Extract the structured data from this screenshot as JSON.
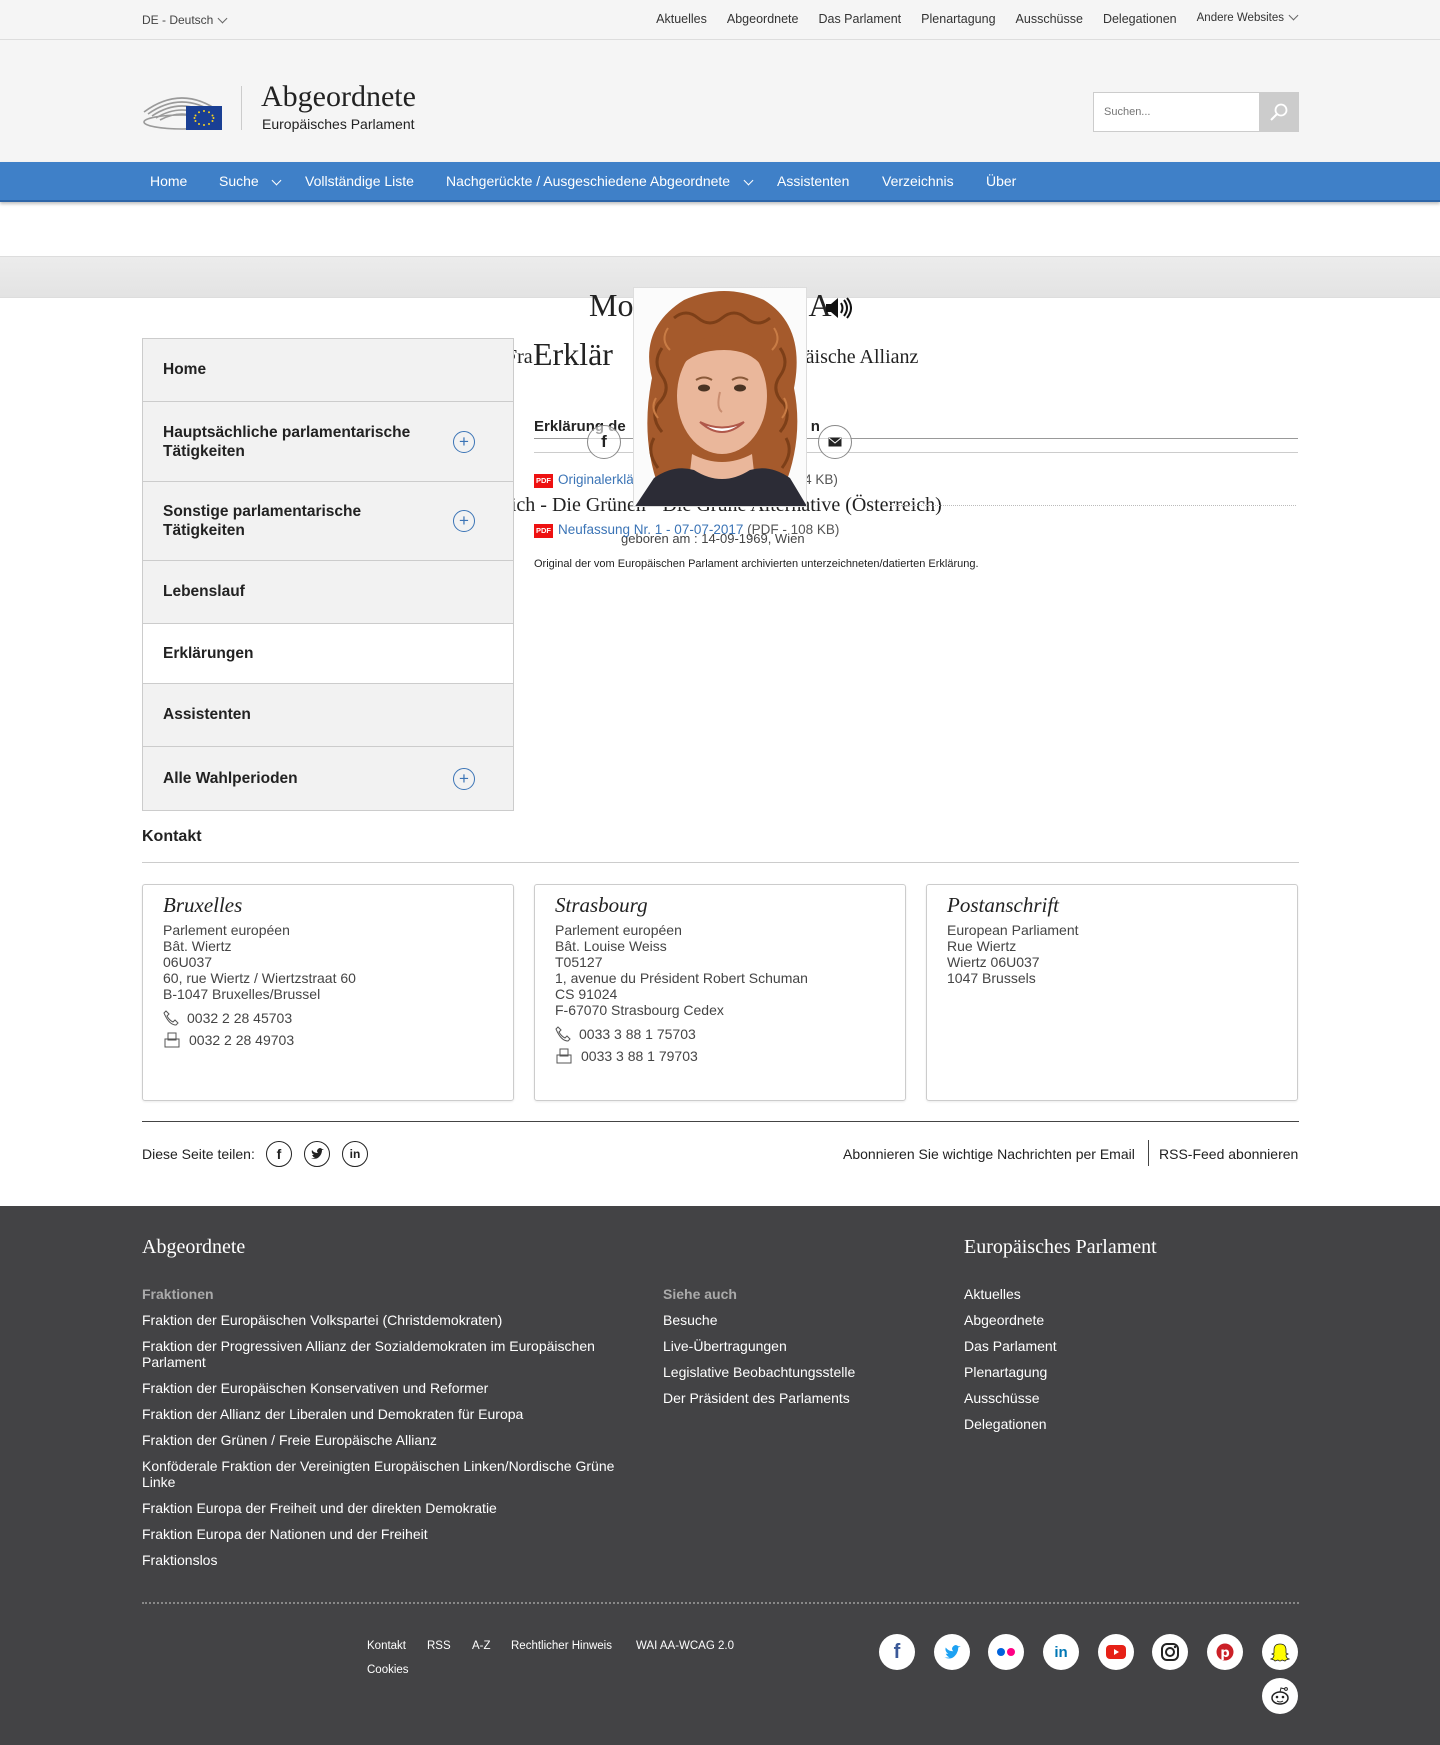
{
  "topbar": {
    "language": "DE - Deutsch",
    "links": [
      "Aktuelles",
      "Abgeordnete",
      "Das Parlament",
      "Plenartagung",
      "Ausschüsse",
      "Delegationen"
    ],
    "other_sites": "Andere Websites"
  },
  "header": {
    "title": "Abgeordnete",
    "subtitle": "Europäisches Parlament",
    "search_placeholder": "Suchen..."
  },
  "nav": {
    "items": [
      "Home",
      "Suche",
      "Vollständige Liste",
      "Nachgerückte / Ausgeschiedene Abgeordnete",
      "Assistenten",
      "Verzeichnis",
      "Über"
    ]
  },
  "profile": {
    "name_visible": "Mo",
    "name_visible_end": "A",
    "page_heading": "Erklär",
    "group_left": "Fra",
    "group_right": "päische Allianz",
    "party": "eich - Die Grünen - Die Grüne Alternative (Österreich)",
    "born": "geboren am : 14-09-1969, Wien"
  },
  "sidebar": {
    "items": [
      {
        "label": "Home",
        "expandable": false,
        "active": false
      },
      {
        "label": "Hauptsächliche parlamentarische Tätigkeiten",
        "expandable": true,
        "active": false
      },
      {
        "label": "Sonstige parlamentarische Tätigkeiten",
        "expandable": true,
        "active": false
      },
      {
        "label": "Lebenslauf",
        "expandable": false,
        "active": false
      },
      {
        "label": "Erklärungen",
        "expandable": false,
        "active": true
      },
      {
        "label": "Assistenten",
        "expandable": false,
        "active": false
      },
      {
        "label": "Alle Wahlperioden",
        "expandable": true,
        "active": false
      }
    ]
  },
  "declarations": {
    "heading": "Erklärung de",
    "heading_end": "n",
    "docs": [
      {
        "badge": "PDF",
        "title": "Originalerklärung - 27-05-2014",
        "size": " (PDF - 104 KB)"
      },
      {
        "badge": "PDF",
        "title": "Neufassung Nr. 1 - 07-07-2017",
        "size": " (PDF - 108 KB)"
      }
    ],
    "note": "Original der vom Europäischen Parlament archivierten unterzeichneten/datierten Erklärung."
  },
  "contact": {
    "title": "Kontakt",
    "cards": [
      {
        "city": "Bruxelles",
        "lines": [
          "Parlement européen",
          "Bât. Wiertz",
          "06U037",
          "60, rue Wiertz / Wiertzstraat 60",
          "B-1047 Bruxelles/Brussel"
        ],
        "phone": "0032 2 28 45703",
        "fax": "0032 2 28 49703"
      },
      {
        "city": "Strasbourg",
        "lines": [
          "Parlement européen",
          "Bât. Louise Weiss",
          "T05127",
          "1, avenue du Président Robert Schuman",
          "CS 91024",
          "F-67070 Strasbourg Cedex"
        ],
        "phone": "0033 3 88 1 75703",
        "fax": "0033 3 88 1 79703"
      },
      {
        "city": "Postanschrift",
        "lines": [
          "European Parliament",
          "Rue Wiertz",
          "Wiertz 06U037",
          "1047 Brussels"
        ]
      }
    ]
  },
  "share": {
    "label": "Diese Seite teilen:",
    "subscribe_email": "Abonnieren Sie wichtige Nachrichten per Email",
    "subscribe_rss": "RSS-Feed abonnieren"
  },
  "footer": {
    "col1_title": "Abgeordnete",
    "col1_category": "Fraktionen",
    "groups": [
      "Fraktion der Europäischen Volkspartei (Christdemokraten)",
      "Fraktion der Progressiven Allianz der Sozialdemokraten im Europäischen Parlament",
      "Fraktion der Europäischen Konservativen und Reformer",
      "Fraktion der Allianz der Liberalen und Demokraten für Europa",
      "Fraktion der Grünen / Freie Europäische Allianz",
      "Konföderale Fraktion der Vereinigten Europäischen Linken/Nordische Grüne Linke",
      "Fraktion Europa der Freiheit und der direkten Demokratie",
      "Fraktion Europa der Nationen und der Freiheit",
      "Fraktionslos"
    ],
    "col2_category": "Siehe auch",
    "see_also": [
      "Besuche",
      "Live-Übertragungen",
      "Legislative Beobachtungsstelle",
      "Der Präsident des Parlaments"
    ],
    "col3_title": "Europäisches Parlament",
    "ep_links": [
      "Aktuelles",
      "Abgeordnete",
      "Das Parlament",
      "Plenartagung",
      "Ausschüsse",
      "Delegationen"
    ],
    "bottom_links": [
      "Kontakt",
      "RSS",
      "A-Z",
      "Rechtlicher Hinweis",
      "WAI AA-WCAG 2.0"
    ],
    "cookies": "Cookies",
    "social": [
      "facebook-icon",
      "twitter-icon",
      "flickr-icon",
      "linkedin-icon",
      "youtube-icon",
      "instagram-icon",
      "pinterest-icon",
      "snapchat-icon",
      "reddit-icon"
    ]
  },
  "colors": {
    "nav_blue": "#3f80c8",
    "link_blue": "#3b74b6",
    "footer_bg": "#434345",
    "pdf_red": "#ee1111"
  }
}
